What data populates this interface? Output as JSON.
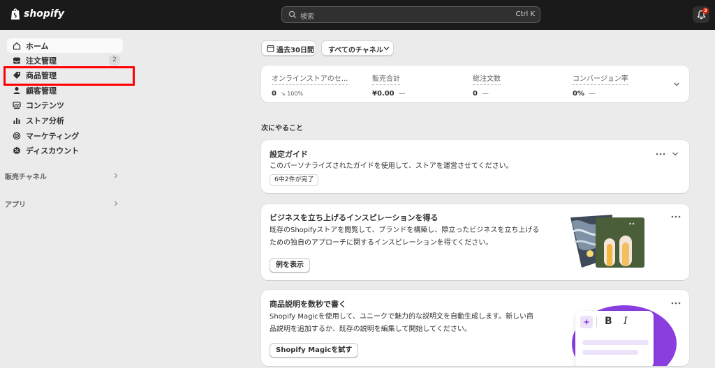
{
  "topbar": {
    "brand": "shopify",
    "search_placeholder": "検索",
    "search_shortcut": "Ctrl K",
    "notification_count": "3"
  },
  "sidebar": {
    "items": [
      {
        "label": "ホーム",
        "icon": "home-icon"
      },
      {
        "label": "注文管理",
        "icon": "inbox-icon",
        "count": "2"
      },
      {
        "label": "商品管理",
        "icon": "tag-icon"
      },
      {
        "label": "顧客管理",
        "icon": "person-icon"
      },
      {
        "label": "コンテンツ",
        "icon": "content-icon"
      },
      {
        "label": "ストア分析",
        "icon": "chart-bar-icon"
      },
      {
        "label": "マーケティング",
        "icon": "target-icon"
      },
      {
        "label": "ディスカウント",
        "icon": "discount-icon"
      }
    ],
    "sales_channels": "販売チャネル",
    "apps": "アプリ",
    "highlight_color": "#ff0000"
  },
  "filters": {
    "date_range": "過去30日間",
    "channel": "すべてのチャネル"
  },
  "metrics": [
    {
      "label": "オンラインストアのセ...",
      "value": "0",
      "sub": "↘ 100%"
    },
    {
      "label": "販売合計",
      "value": "¥0.00",
      "dash": "—"
    },
    {
      "label": "総注文数",
      "value": "0",
      "dash": "—"
    },
    {
      "label": "コンバージョン率",
      "value": "0%",
      "dash": "—"
    }
  ],
  "next_steps_heading": "次にやること",
  "setup_guide": {
    "title": "設定ガイド",
    "description": "このパーソナライズされたガイドを使用して、ストアを運営させてください。",
    "progress": "6中2件が完了"
  },
  "inspiration": {
    "title": "ビジネスを立ち上げるインスピレーションを得る",
    "line1": "既存のShopifyストアを閲覧して、ブランドを構築し、際立ったビジネスを立ち上げる",
    "line2": "ための独自のアプローチに関するインスピレーションを得てください。",
    "button": "例を表示"
  },
  "magic": {
    "title": "商品説明を数秒で書く",
    "line1": "Shopify Magicを使用して、ユニークで魅力的な説明文を自動生成します。新しい商",
    "line2": "品説明を追加するか、既存の説明を編集して開始してください。",
    "button": "Shopify Magicを試す",
    "toolbar_bold": "B",
    "toolbar_italic": "I"
  }
}
